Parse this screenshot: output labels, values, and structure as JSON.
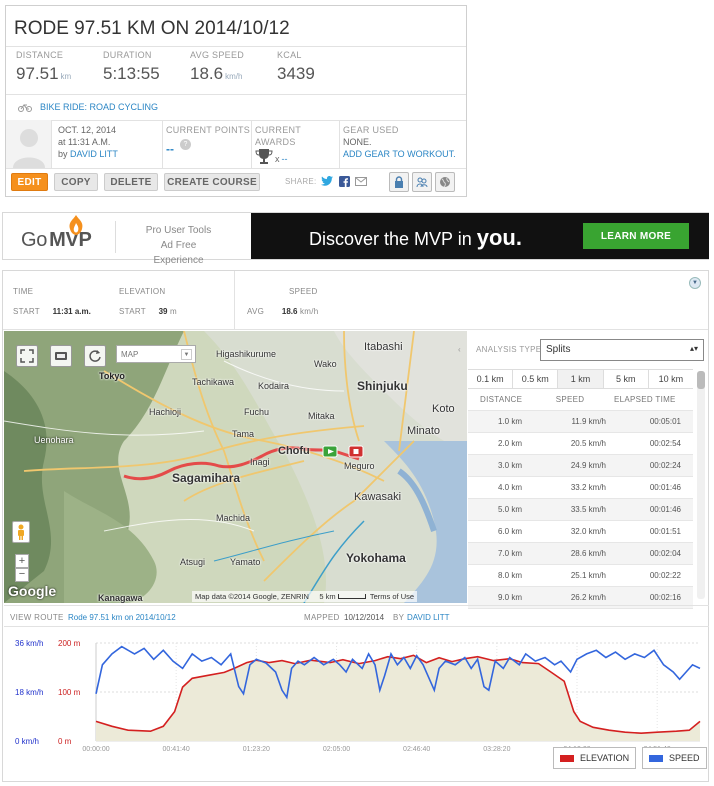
{
  "workout": {
    "title": "RODE 97.51 KM ON 2014/10/12",
    "stats": [
      {
        "label": "DISTANCE",
        "value": "97.51",
        "unit": "km"
      },
      {
        "label": "DURATION",
        "value": "5:13:55",
        "unit": ""
      },
      {
        "label": "AVG SPEED",
        "value": "18.6",
        "unit": "km/h"
      },
      {
        "label": "KCAL",
        "value": "3439",
        "unit": ""
      }
    ],
    "activity": "BIKE RIDE: ROAD CYCLING",
    "date_line1": "OCT. 12, 2014",
    "date_line2": "at 11:31 A.M.",
    "by_prefix": "by",
    "author": "DAVID LITT",
    "current_points_label": "CURRENT POINTS",
    "current_points_value": "--",
    "current_awards_label": "CURRENT AWARDS",
    "awards_count_prefix": "x",
    "awards_count": "--",
    "gear_label": "GEAR USED",
    "gear_value": "NONE.",
    "gear_link": "ADD GEAR TO WORKOUT.",
    "buttons": {
      "edit": "EDIT",
      "copy": "COPY",
      "delete": "DELETE",
      "create_course": "CREATE COURSE"
    },
    "share_label": "SHARE:"
  },
  "banner": {
    "brand_go": "Go",
    "brand_mvp": "MVP",
    "pro_line1": "Pro User Tools",
    "pro_line2": "Ad Free Experience",
    "discover": "Discover the MVP in",
    "discover_em": "you.",
    "learn_more": "LEARN MORE"
  },
  "summary": {
    "time_label": "TIME",
    "time_start_label": "START",
    "time_start_value": "11:31 a.m.",
    "elevation_label": "ELEVATION",
    "elev_start_label": "START",
    "elev_start_value": "39",
    "elev_unit": "m",
    "speed_label": "SPEED",
    "speed_avg_label": "AVG",
    "speed_avg_value": "18.6",
    "speed_unit": "km/h"
  },
  "map": {
    "type_select": "MAP",
    "copyright": "Map data ©2014 Google, ZENRIN",
    "scale": "5 km",
    "terms": "Terms of Use",
    "google": "Google",
    "places": [
      {
        "name": "Tokyo",
        "id": "tokyo"
      },
      {
        "name": "Itabashi",
        "id": "itabashi"
      },
      {
        "name": "Higashikurume",
        "id": "higashikurume"
      },
      {
        "name": "Wako",
        "id": "wako"
      },
      {
        "name": "Tachikawa",
        "id": "tachikawa"
      },
      {
        "name": "Kodaira",
        "id": "kodaira"
      },
      {
        "name": "Shinjuku",
        "id": "shinjuku"
      },
      {
        "name": "Hachioji",
        "id": "hachioji"
      },
      {
        "name": "Fuchu",
        "id": "fuchu"
      },
      {
        "name": "Mitaka",
        "id": "mitaka"
      },
      {
        "name": "Chofu",
        "id": "chofu"
      },
      {
        "name": "Minato",
        "id": "minato"
      },
      {
        "name": "Koto",
        "id": "koto"
      },
      {
        "name": "Sagamihara",
        "id": "sagamihara"
      },
      {
        "name": "Machida",
        "id": "machida"
      },
      {
        "name": "Kawasaki",
        "id": "kawasaki"
      },
      {
        "name": "Yokohama",
        "id": "yokohama"
      },
      {
        "name": "Atsugi",
        "id": "atsugi"
      },
      {
        "name": "Kanagawa",
        "id": "kanagawa"
      },
      {
        "name": "Meguro",
        "id": "meguro"
      },
      {
        "name": "Uenohara",
        "id": "uenohara"
      },
      {
        "name": "Yamato",
        "id": "yamato"
      },
      {
        "name": "Tama",
        "id": "tama"
      },
      {
        "name": "Inagi",
        "id": "inagi"
      }
    ]
  },
  "splits": {
    "analysis_label": "ANALYSIS TYPE",
    "analysis_value": "Splits",
    "tabs": [
      "0.1 km",
      "0.5 km",
      "1 km",
      "5 km",
      "10 km"
    ],
    "active_tab": 2,
    "headers": {
      "distance": "DISTANCE",
      "speed": "SPEED",
      "elapsed": "ELAPSED TIME"
    },
    "rows": [
      {
        "distance": "1.0 km",
        "speed": "11.9 km/h",
        "elapsed": "00:05:01"
      },
      {
        "distance": "2.0 km",
        "speed": "20.5 km/h",
        "elapsed": "00:02:54"
      },
      {
        "distance": "3.0 km",
        "speed": "24.9 km/h",
        "elapsed": "00:02:24"
      },
      {
        "distance": "4.0 km",
        "speed": "33.2 km/h",
        "elapsed": "00:01:46"
      },
      {
        "distance": "5.0 km",
        "speed": "33.5 km/h",
        "elapsed": "00:01:46"
      },
      {
        "distance": "6.0 km",
        "speed": "32.0 km/h",
        "elapsed": "00:01:51"
      },
      {
        "distance": "7.0 km",
        "speed": "28.6 km/h",
        "elapsed": "00:02:04"
      },
      {
        "distance": "8.0 km",
        "speed": "25.1 km/h",
        "elapsed": "00:02:22"
      },
      {
        "distance": "9.0 km",
        "speed": "26.2 km/h",
        "elapsed": "00:02:16"
      }
    ]
  },
  "view_route": {
    "label": "VIEW ROUTE",
    "route_name": "Rode 97.51 km on 2014/10/12",
    "mapped_label": "MAPPED",
    "mapped_date": "10/12/2014",
    "by_label": "BY",
    "author": "DAVID LITT"
  },
  "colors": {
    "accent": "#f5901d",
    "link": "#2b86c5",
    "elevation": "#d42020",
    "speed": "#3366dd",
    "route": "#e53c3c"
  },
  "chart_data": {
    "type": "line",
    "x_ticks": [
      "00:00:00",
      "00:41:40",
      "01:23:20",
      "02:05:00",
      "02:46:40",
      "03:28:20",
      "04:10:00",
      "04:51:40"
    ],
    "x_ticks_seconds": [
      0,
      2500,
      5000,
      7500,
      10000,
      12500,
      15000,
      17500
    ],
    "x_range": [
      0,
      18835
    ],
    "left_axis_ticks": [
      "36 km/h",
      "18 km/h",
      "0 km/h"
    ],
    "right_axis_ticks": [
      "200 m",
      "100 m",
      "0 m"
    ],
    "speed_range": [
      -18,
      36
    ],
    "elevation_range": [
      0,
      200
    ],
    "series": [
      {
        "name": "ELEVATION",
        "color": "#d42020",
        "fill": "#ecead8",
        "points": [
          [
            0,
            40
          ],
          [
            500,
            30
          ],
          [
            1000,
            22
          ],
          [
            1700,
            20
          ],
          [
            2100,
            30
          ],
          [
            2450,
            60
          ],
          [
            2700,
            110
          ],
          [
            3000,
            128
          ],
          [
            3500,
            134
          ],
          [
            4000,
            140
          ],
          [
            4300,
            148
          ],
          [
            4700,
            160
          ],
          [
            5000,
            165
          ],
          [
            5400,
            160
          ],
          [
            5800,
            164
          ],
          [
            6200,
            158
          ],
          [
            6700,
            165
          ],
          [
            7300,
            160
          ],
          [
            7700,
            166
          ],
          [
            8200,
            158
          ],
          [
            8700,
            164
          ],
          [
            9100,
            172
          ],
          [
            9500,
            168
          ],
          [
            9900,
            175
          ],
          [
            10300,
            160
          ],
          [
            10700,
            170
          ],
          [
            11100,
            162
          ],
          [
            11500,
            168
          ],
          [
            11900,
            172
          ],
          [
            12400,
            164
          ],
          [
            12900,
            168
          ],
          [
            13300,
            160
          ],
          [
            13800,
            158
          ],
          [
            14200,
            140
          ],
          [
            14600,
            122
          ],
          [
            14900,
            60
          ],
          [
            15100,
            40
          ],
          [
            15500,
            28
          ],
          [
            16000,
            22
          ],
          [
            16500,
            18
          ],
          [
            17000,
            16
          ],
          [
            17500,
            18
          ],
          [
            18100,
            20
          ],
          [
            18500,
            22
          ],
          [
            18835,
            40
          ]
        ]
      },
      {
        "name": "SPEED",
        "color": "#3366dd",
        "points": [
          [
            0,
            8
          ],
          [
            200,
            24
          ],
          [
            500,
            30
          ],
          [
            800,
            34
          ],
          [
            1200,
            30
          ],
          [
            1500,
            33
          ],
          [
            1800,
            27
          ],
          [
            2100,
            32
          ],
          [
            2400,
            26
          ],
          [
            2700,
            22
          ],
          [
            3000,
            30
          ],
          [
            3300,
            26
          ],
          [
            3600,
            28
          ],
          [
            3900,
            24
          ],
          [
            4200,
            30
          ],
          [
            4450,
            12
          ],
          [
            4600,
            8
          ],
          [
            4800,
            24
          ],
          [
            5000,
            27
          ],
          [
            5300,
            25
          ],
          [
            5600,
            20
          ],
          [
            5800,
            10
          ],
          [
            5950,
            6
          ],
          [
            6100,
            22
          ],
          [
            6300,
            26
          ],
          [
            6500,
            24
          ],
          [
            6800,
            28
          ],
          [
            7100,
            24
          ],
          [
            7400,
            27
          ],
          [
            7600,
            24
          ],
          [
            7800,
            20
          ],
          [
            8000,
            27
          ],
          [
            8300,
            22
          ],
          [
            8500,
            30
          ],
          [
            8700,
            24
          ],
          [
            8850,
            10
          ],
          [
            9000,
            18
          ],
          [
            9200,
            30
          ],
          [
            9400,
            24
          ],
          [
            9600,
            28
          ],
          [
            9800,
            22
          ],
          [
            10000,
            29
          ],
          [
            10200,
            24
          ],
          [
            10400,
            16
          ],
          [
            10550,
            10
          ],
          [
            10700,
            22
          ],
          [
            10900,
            26
          ],
          [
            11200,
            24
          ],
          [
            11500,
            28
          ],
          [
            11700,
            22
          ],
          [
            11900,
            27
          ],
          [
            12100,
            12
          ],
          [
            12250,
            10
          ],
          [
            12450,
            26
          ],
          [
            12700,
            22
          ],
          [
            12900,
            28
          ],
          [
            13200,
            24
          ],
          [
            13400,
            30
          ],
          [
            13700,
            26
          ],
          [
            14000,
            28
          ],
          [
            14300,
            24
          ],
          [
            14500,
            26
          ],
          [
            14800,
            20
          ],
          [
            15000,
            27
          ],
          [
            15300,
            30
          ],
          [
            15600,
            32
          ],
          [
            15900,
            28
          ],
          [
            16200,
            31
          ],
          [
            16500,
            27
          ],
          [
            16800,
            30
          ],
          [
            17100,
            28
          ],
          [
            17400,
            32
          ],
          [
            17700,
            24
          ],
          [
            18000,
            20
          ],
          [
            18200,
            16
          ],
          [
            18400,
            20
          ],
          [
            18600,
            24
          ],
          [
            18835,
            22
          ]
        ]
      }
    ]
  }
}
